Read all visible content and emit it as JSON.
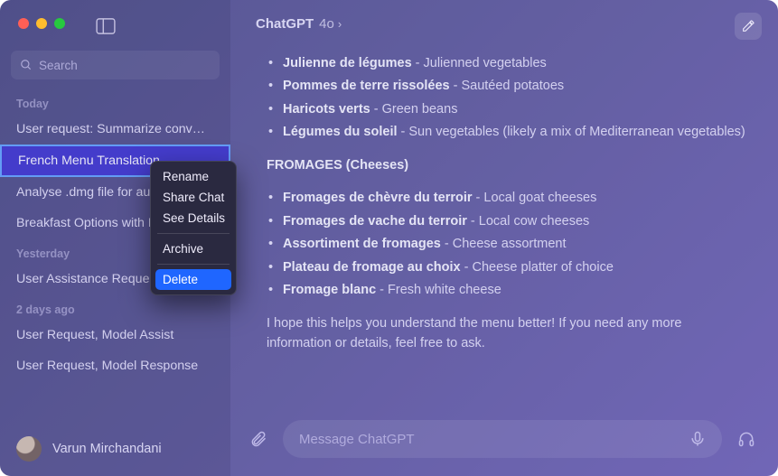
{
  "header": {
    "title": "ChatGPT",
    "model": "4o"
  },
  "search": {
    "placeholder": "Search"
  },
  "sections": [
    {
      "label": "Today",
      "items": [
        "User request: Summarize conv…",
        "French Menu Translation",
        "Analyse .dmg file for authenticity",
        "Breakfast Options with Eggs"
      ],
      "selectedIndex": 1
    },
    {
      "label": "Yesterday",
      "items": [
        "User Assistance Request"
      ]
    },
    {
      "label": "2 days ago",
      "items": [
        "User Request, Model Assist",
        "User Request, Model Response"
      ]
    }
  ],
  "user": {
    "name": "Varun Mirchandani"
  },
  "contextMenu": {
    "items": [
      "Rename",
      "Share Chat",
      "See Details"
    ],
    "secondary": [
      "Archive"
    ],
    "danger": "Delete"
  },
  "content": {
    "garnitures": [
      {
        "fr": "Julienne de légumes",
        "en": " - Julienned vegetables"
      },
      {
        "fr": "Pommes de terre rissolées",
        "en": " - Sautéed potatoes"
      },
      {
        "fr": "Haricots verts",
        "en": " - Green beans"
      },
      {
        "fr": "Légumes du soleil",
        "en": " - Sun vegetables (likely a mix of Mediterranean vegetables)"
      }
    ],
    "fromagesHeader": "FROMAGES (Cheeses)",
    "fromages": [
      {
        "fr": "Fromages de chèvre du terroir",
        "en": " - Local goat cheeses"
      },
      {
        "fr": "Fromages de vache du terroir",
        "en": " - Local cow cheeses"
      },
      {
        "fr": "Assortiment de fromages",
        "en": " - Cheese assortment"
      },
      {
        "fr": "Plateau de fromage au choix",
        "en": " - Cheese platter of choice"
      },
      {
        "fr": "Fromage blanc",
        "en": " - Fresh white cheese"
      }
    ],
    "closing": "I hope this helps you understand the menu better! If you need any more information or details, feel free to ask."
  },
  "input": {
    "placeholder": "Message ChatGPT"
  }
}
